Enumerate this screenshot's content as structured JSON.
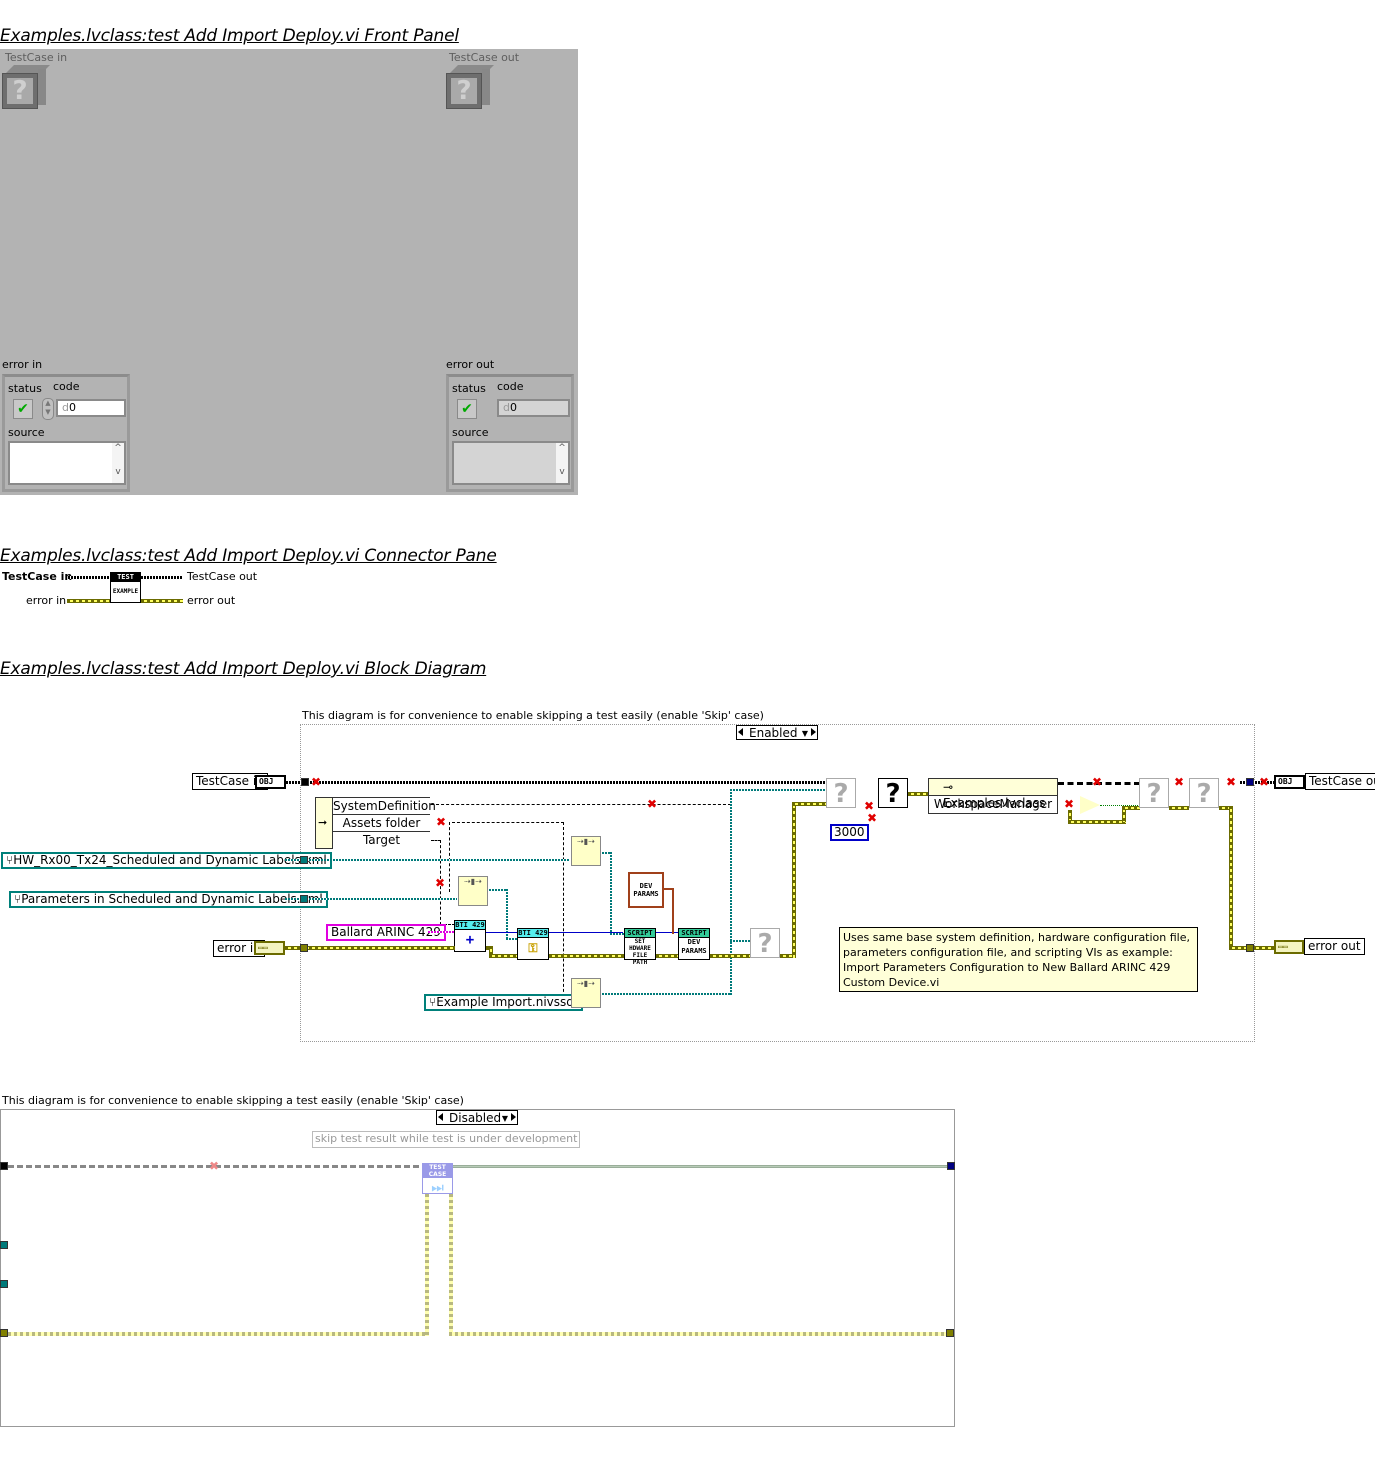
{
  "front_panel": {
    "title": "Examples.lvclass:test Add Import Deploy.vi Front Panel",
    "testcase_in": {
      "label": "TestCase in",
      "icon": "question-mark-class-icon"
    },
    "testcase_out": {
      "label": "TestCase out",
      "icon": "question-mark-class-icon"
    },
    "error_in": {
      "label": "error in",
      "status_label": "status",
      "status_value": "✔",
      "code_label": "code",
      "code_value": "0",
      "code_prefix": "d",
      "source_label": "source",
      "source_value": ""
    },
    "error_out": {
      "label": "error out",
      "status_label": "status",
      "status_value": "✔",
      "code_label": "code",
      "code_value": "0",
      "code_prefix": "d",
      "source_label": "source",
      "source_value": ""
    },
    "scroll_up": "^",
    "scroll_down": "v"
  },
  "connector_pane": {
    "title": "Examples.lvclass:test Add Import Deploy.vi Connector Pane",
    "inputs": [
      "TestCase in",
      "error in"
    ],
    "outputs": [
      "TestCase out",
      "error out"
    ],
    "icon_top": "TEST",
    "icon_bottom": "EXAMPLE"
  },
  "block_diagram": {
    "title": "Examples.lvclass:test Add Import Deploy.vi Block Diagram",
    "enabled_diagram": {
      "caption": "This diagram is for convenience to enable skipping a test easily (enable 'Skip' case)",
      "case_selector": "Enabled",
      "testcase_in": "TestCase in",
      "testcase_out": "TestCase out",
      "error_in": "error in",
      "error_out": "error out",
      "obj_term": "OBJ",
      "property_node": {
        "rows": [
          "SystemDefinition",
          "Assets folder",
          "Target"
        ]
      },
      "path_constants": [
        "HW_Rx00_Tx24_Scheduled and Dynamic Labels.xml",
        "Parameters in Scheduled and Dynamic Labels.xml",
        "Example Import.nivssdf"
      ],
      "string_constant": "Ballard ARINC 429",
      "numeric_constant": "3000",
      "bti_icon_label": "BTI 429",
      "script_icons": [
        {
          "band": "SCRIPT",
          "text": "SET HDWARE FILE PATH"
        },
        {
          "band": "SCRIPT",
          "text": "DEV PARAMS"
        }
      ],
      "dev_params_label": "DEV PARAMS",
      "class_node": {
        "class": "Examples.lvclass",
        "member": "WorkspaceManager"
      },
      "comment": "Uses same base system definition, hardware configuration file, parameters configuration file, and scripting VIs as example: Import Parameters Configuration to New Ballard ARINC 429 Custom Device.vi",
      "question_glyph": "?"
    },
    "disabled_diagram": {
      "caption": "This diagram is for convenience to enable skipping a test easily (enable 'Skip' case)",
      "case_selector": "Disabled",
      "label": "skip test result while test is under development",
      "skip_icon_band": "TEST CASE"
    }
  },
  "colors": {
    "panel_bg": "#b3b3b3",
    "error_wire": "#6b6b00",
    "path_wire": "#007a7a",
    "string_wire": "#e000e0",
    "numeric_wire": "#0000c8",
    "ok_check": "#00aa00",
    "comment_bg": "#ffffd8"
  }
}
